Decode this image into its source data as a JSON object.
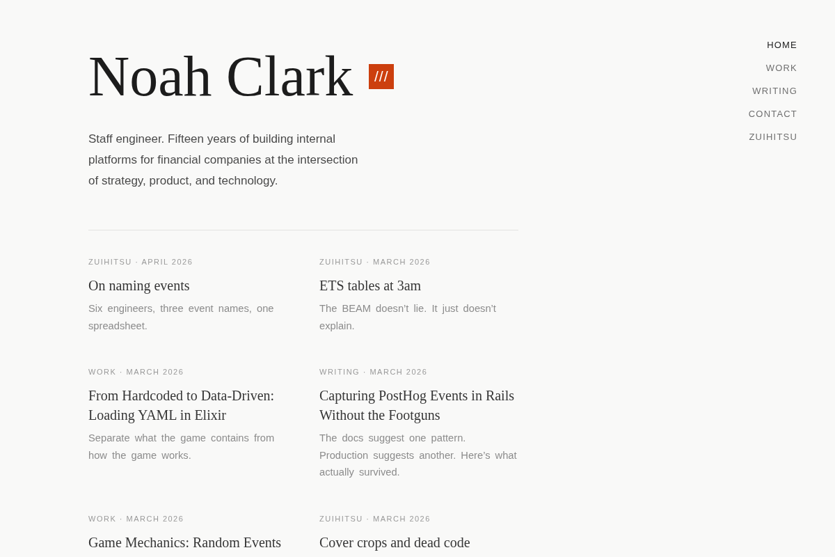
{
  "header": {
    "name": "Noah Clark",
    "logo": "///",
    "intro": "Staff engineer. Fifteen years of building internal platforms for financial companies at the intersection of strategy, product, and technology."
  },
  "nav": [
    {
      "label": "HOME",
      "selected": true
    },
    {
      "label": "WORK",
      "selected": false
    },
    {
      "label": "WRITING",
      "selected": false
    },
    {
      "label": "CONTACT",
      "selected": false
    },
    {
      "label": "ZUIHITSU",
      "selected": false
    }
  ],
  "posts": [
    {
      "meta": "ZUIHITSU · APRIL 2026",
      "title": "On naming events",
      "excerpt": "Six engineers, three event names, one spreadsheet."
    },
    {
      "meta": "ZUIHITSU · MARCH 2026",
      "title": "ETS tables at 3am",
      "excerpt": "The BEAM doesn’t lie. It just doesn’t explain."
    },
    {
      "meta": "WORK · MARCH 2026",
      "title": "From Hardcoded to Data-Driven: Loading YAML in Elixir",
      "excerpt": "Separate what the game contains from how the game works."
    },
    {
      "meta": "WRITING · MARCH 2026",
      "title": "Capturing PostHog Events in Rails Without the Footguns",
      "excerpt": "The docs suggest one pattern. Production suggests another. Here’s what actually survived."
    },
    {
      "meta": "WORK · MARCH 2026",
      "title": "Game Mechanics: Random Events"
    },
    {
      "meta": "ZUIHITSU · MARCH 2026",
      "title": "Cover crops and dead code"
    }
  ]
}
